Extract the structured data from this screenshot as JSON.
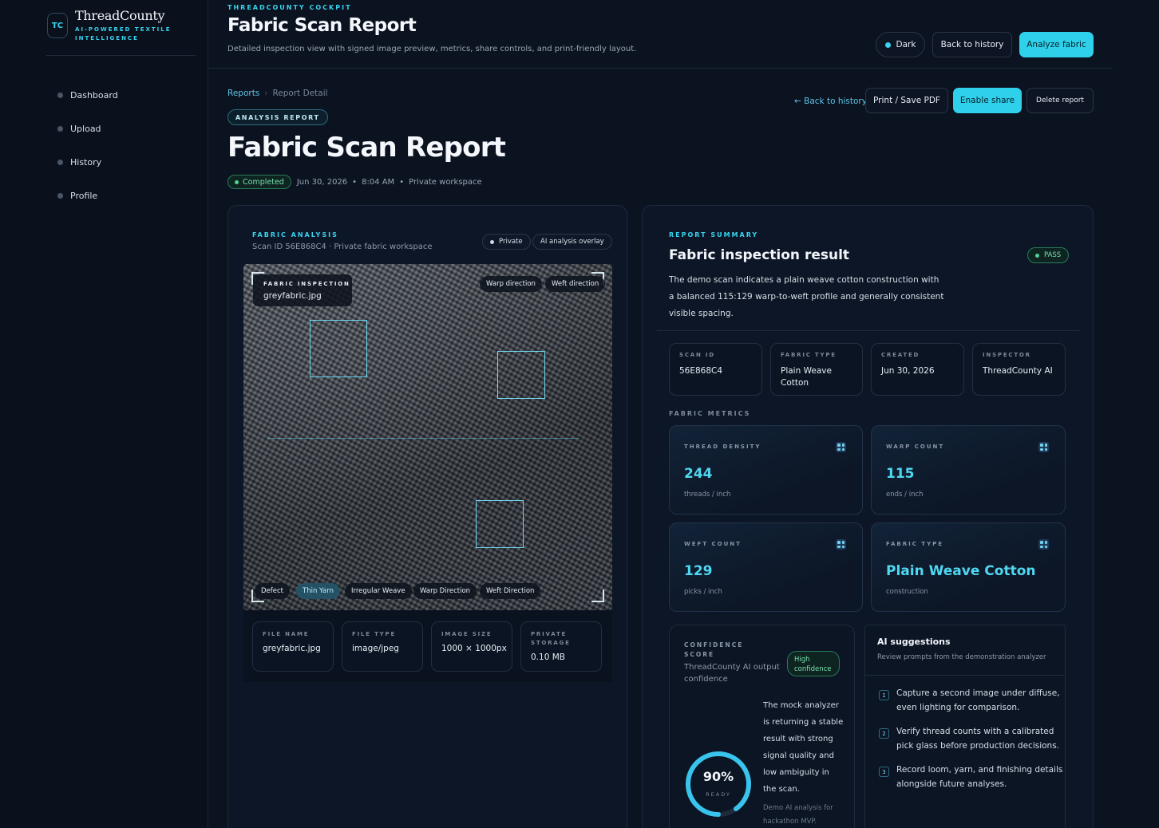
{
  "brand": {
    "badge": "TC",
    "name": "ThreadCounty",
    "tagline": "AI-POWERED TEXTILE INTELLIGENCE"
  },
  "nav": [
    {
      "label": "Dashboard"
    },
    {
      "label": "Upload"
    },
    {
      "label": "History"
    },
    {
      "label": "Profile"
    }
  ],
  "header": {
    "kicker": "THREADCOUNTY COCKPIT",
    "title": "Fabric Scan Report",
    "subtitle": "Detailed inspection view with signed image preview, metrics, share controls, and print-friendly layout.",
    "theme_label": "Dark",
    "back_label": "Back to history",
    "analyze_label": "Analyze fabric"
  },
  "breadcrumb": {
    "root": "Reports",
    "sep": "›",
    "current": "Report Detail"
  },
  "actions": {
    "back_link": "← Back to history",
    "print": "Print / Save PDF",
    "share": "Enable share",
    "delete": "Delete report"
  },
  "report": {
    "label": "ANALYSIS REPORT",
    "title": "Fabric Scan Report",
    "status": "Completed",
    "date": "Jun 30, 2026",
    "time": "8:04 AM",
    "workspace": "Private workspace"
  },
  "analysis": {
    "label": "FABRIC ANALYSIS",
    "scan_line": "Scan ID 56E868C4 · Private fabric workspace",
    "chip_private": "Private",
    "chip_overlay": "AI analysis overlay",
    "inspect_label": "FABRIC INSPECTION",
    "inspect_file": "greyfabric.jpg",
    "warp_tag": "Warp direction",
    "weft_tag": "Weft direction",
    "legend": [
      {
        "label": "Defect",
        "active": false
      },
      {
        "label": "Thin Yarn",
        "active": true
      },
      {
        "label": "Irregular Weave",
        "active": false
      },
      {
        "label": "Warp Direction",
        "active": false
      },
      {
        "label": "Weft Direction",
        "active": false
      }
    ]
  },
  "file_info": [
    {
      "key": "FILE NAME",
      "value": "greyfabric.jpg"
    },
    {
      "key": "FILE TYPE",
      "value": "image/jpeg"
    },
    {
      "key": "IMAGE SIZE",
      "value": "1000 × 1000px"
    },
    {
      "key": "PRIVATE STORAGE",
      "value": "0.10 MB"
    }
  ],
  "summary": {
    "label": "REPORT SUMMARY",
    "title": "Fabric inspection result",
    "badge": "PASS",
    "desc1": "The demo scan indicates a plain weave cotton construction with",
    "desc2": "a balanced 115:129 warp-to-weft profile and generally consistent",
    "desc3": "visible spacing.",
    "boxes": [
      {
        "key": "SCAN ID",
        "value": "56E868C4"
      },
      {
        "key": "FABRIC TYPE",
        "value": "Plain Weave Cotton"
      },
      {
        "key": "CREATED",
        "value": "Jun 30, 2026"
      },
      {
        "key": "INSPECTOR",
        "value": "ThreadCounty AI"
      }
    ]
  },
  "metrics_label": "FABRIC METRICS",
  "metrics": [
    {
      "key": "THREAD DENSITY",
      "value": "244",
      "unit": "threads / inch"
    },
    {
      "key": "WARP COUNT",
      "value": "115",
      "unit": "ends / inch"
    },
    {
      "key": "WEFT COUNT",
      "value": "129",
      "unit": "picks / inch"
    },
    {
      "key": "FABRIC TYPE",
      "value": "Plain Weave Cotton",
      "unit": "construction"
    }
  ],
  "confidence": {
    "label1": "CONFIDENCE",
    "label2": "SCORE",
    "sub1": "ThreadCounty AI output",
    "sub2": "confidence",
    "badge1": "High",
    "badge2": "confidence",
    "value": "90%",
    "fraction": 0.9,
    "ready": "READY",
    "text": [
      "The mock analyzer",
      "is returning a stable",
      "result with strong",
      "signal quality and",
      "low ambiguity in",
      "the scan."
    ],
    "note": [
      "Demo AI analysis for",
      "hackathon MVP."
    ]
  },
  "suggestions": {
    "title": "AI suggestions",
    "sub": "Review prompts from the demonstration analyzer",
    "items": [
      {
        "n": "1",
        "l1": "Capture a second image under diffuse,",
        "l2": "even lighting for comparison."
      },
      {
        "n": "2",
        "l1": "Verify thread counts with a calibrated",
        "l2": "pick glass before production decisions."
      },
      {
        "n": "3",
        "l1": "Record loom, yarn, and finishing details",
        "l2": "alongside future analyses."
      }
    ]
  },
  "colors": {
    "accent": "#2fd0ea",
    "pass": "#4ed39a",
    "bg": "#0b1220"
  }
}
